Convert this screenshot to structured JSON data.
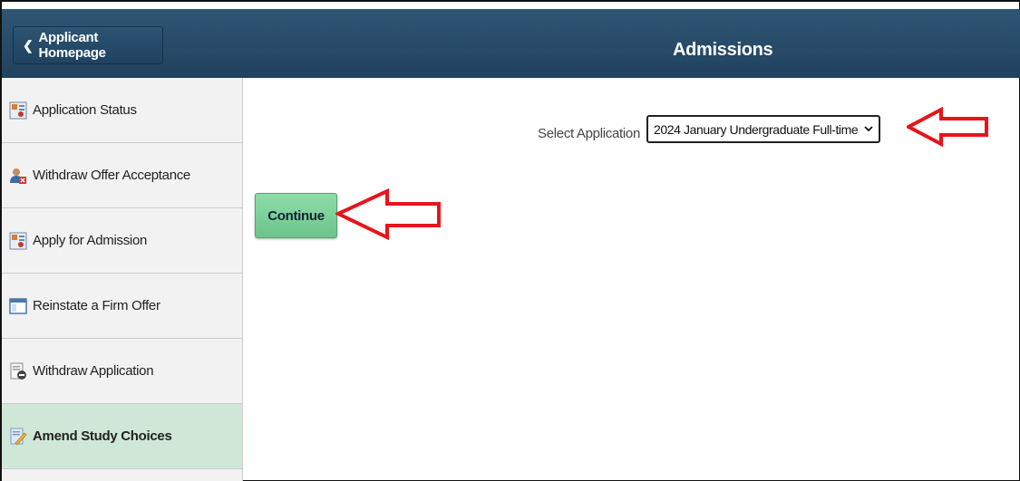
{
  "header": {
    "back_label": "Applicant Homepage",
    "title": "Admissions",
    "back_icon": "chevron-left-icon"
  },
  "sidebar": {
    "items": [
      {
        "label": "Application Status",
        "icon": "status-icon"
      },
      {
        "label": "Withdraw Offer Acceptance",
        "icon": "user-remove-icon"
      },
      {
        "label": "Apply for Admission",
        "icon": "application-icon"
      },
      {
        "label": "Reinstate a Firm Offer",
        "icon": "window-icon"
      },
      {
        "label": "Withdraw Application",
        "icon": "document-minus-icon"
      },
      {
        "label": "Amend Study Choices",
        "icon": "edit-icon",
        "active": true
      }
    ]
  },
  "main": {
    "select_label": "Select Application",
    "select_value": "2024 January Undergraduate Full-time",
    "continue_label": "Continue"
  },
  "colors": {
    "header": "#20425f",
    "active_item": "#cfe7d6",
    "continue_button": "#7ccf98",
    "annotation_arrow": "#e8141b"
  }
}
